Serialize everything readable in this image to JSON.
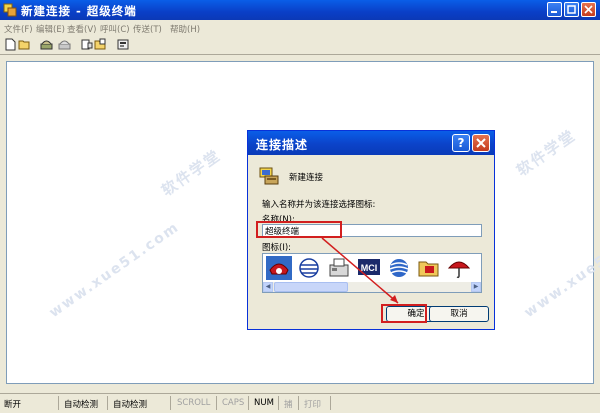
{
  "window": {
    "title": "新建连接 - 超级终端",
    "icon": "hyperterminal-icon"
  },
  "menu": [
    {
      "label": "文件(F)"
    },
    {
      "label": "编辑(E)"
    },
    {
      "label": "查看(V)"
    },
    {
      "label": "呼叫(C)"
    },
    {
      "label": "传送(T)"
    },
    {
      "label": "帮助(H)"
    }
  ],
  "toolbar": [
    "new-icon",
    "open-icon",
    "connect-icon",
    "disconnect-icon",
    "send-icon",
    "receive-icon",
    "properties-icon"
  ],
  "watermarks": [
    "软件学堂",
    "www.xue51.com"
  ],
  "dialog": {
    "title": "连接描述",
    "help_label": "?",
    "connection_label": "新建连接",
    "prompt": "输入名称并为该连接选择图标:",
    "name_label": "名称(N):",
    "name_value": "超级终端",
    "icon_label": "图标(I):",
    "icon_choices": [
      "phone-icon",
      "globe-icon",
      "fax-icon",
      "mci-icon",
      "att-globe-icon",
      "folder-icon",
      "umbrella-icon"
    ],
    "selected_icon": 0,
    "mci_text": "MCI",
    "ok_label": "确定",
    "cancel_label": "取消"
  },
  "statusbar": {
    "items": [
      "断开",
      "自动检测",
      "自动检测",
      "SCROLL",
      "CAPS",
      "NUM",
      "捕",
      "打印"
    ]
  },
  "colors": {
    "titlebar": "#0a43c9",
    "highlight": "#d21f1f",
    "client_bg": "#ffffff"
  }
}
